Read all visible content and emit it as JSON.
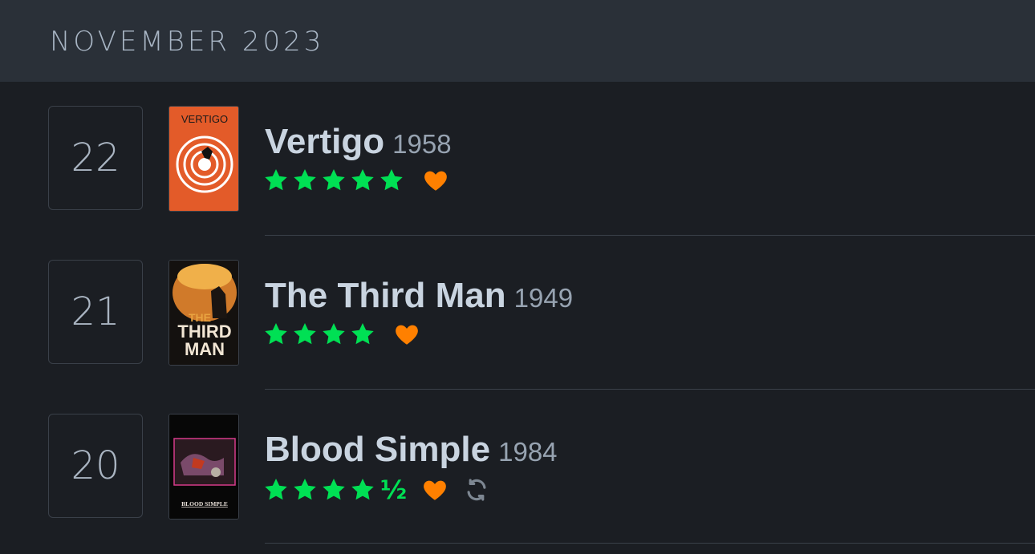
{
  "header": {
    "month": "NOVEMBER 2023"
  },
  "entries": [
    {
      "day": "22",
      "title": "Vertigo",
      "year": "1958",
      "stars": 5,
      "half": false,
      "liked": true,
      "rewatch": false,
      "poster_text": "VERTIGO"
    },
    {
      "day": "21",
      "title": "The Third Man",
      "year": "1949",
      "stars": 4,
      "half": false,
      "liked": true,
      "rewatch": false,
      "poster_text": [
        "THE",
        "THIRD",
        "MAN"
      ]
    },
    {
      "day": "20",
      "title": "Blood Simple",
      "year": "1984",
      "stars": 4,
      "half": true,
      "half_symbol": "½",
      "liked": true,
      "rewatch": true,
      "poster_text": "BLOOD SIMPLE"
    }
  ],
  "colors": {
    "star": "#00e054",
    "heart": "#ff8000",
    "rewatch_icon": "#7d8792"
  },
  "icons": {
    "star": "star-icon",
    "heart": "heart-icon",
    "rewatch": "rewatch-icon"
  }
}
